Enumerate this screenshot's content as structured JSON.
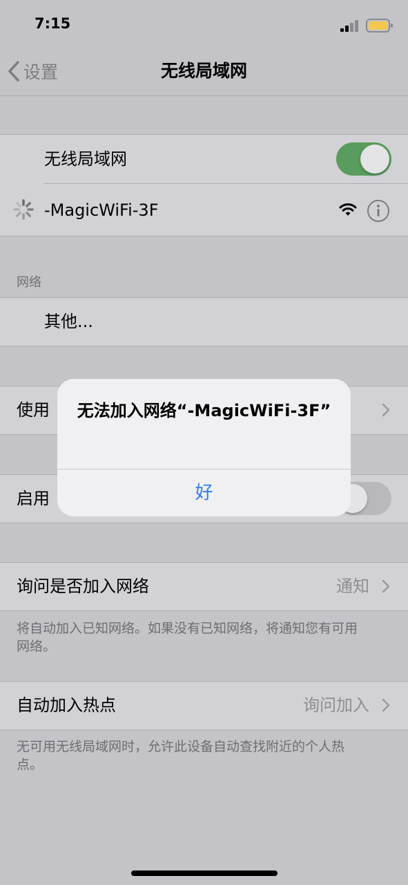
{
  "status_bar": {
    "time": "7:15"
  },
  "nav": {
    "back_label": "设置",
    "title": "无线局域网"
  },
  "wifi_group": {
    "toggle_label": "无线局域网",
    "toggle_on": true,
    "current_network": "-MagicWiFi-3F"
  },
  "networks_section": {
    "header": "网络",
    "other_label": "其他..."
  },
  "row_use_partial": "使用",
  "row_enable_partial": "启用",
  "ask_join": {
    "label": "询问是否加入网络",
    "value": "通知",
    "footer": "将自动加入已知网络。如果没有已知网络，将通知您有可用网络。"
  },
  "auto_hotspot": {
    "label": "自动加入热点",
    "value": "询问加入",
    "footer": "无可用无线局域网时，允许此设备自动查找附近的个人热点。"
  },
  "alert": {
    "title": "无法加入网络“-MagicWiFi-3F”",
    "button": "好"
  },
  "colors": {
    "toggle_on": "#5a9c5e",
    "link_blue": "#2f7df6",
    "background": "#c4c4c8",
    "cell": "#d2d2d6"
  }
}
